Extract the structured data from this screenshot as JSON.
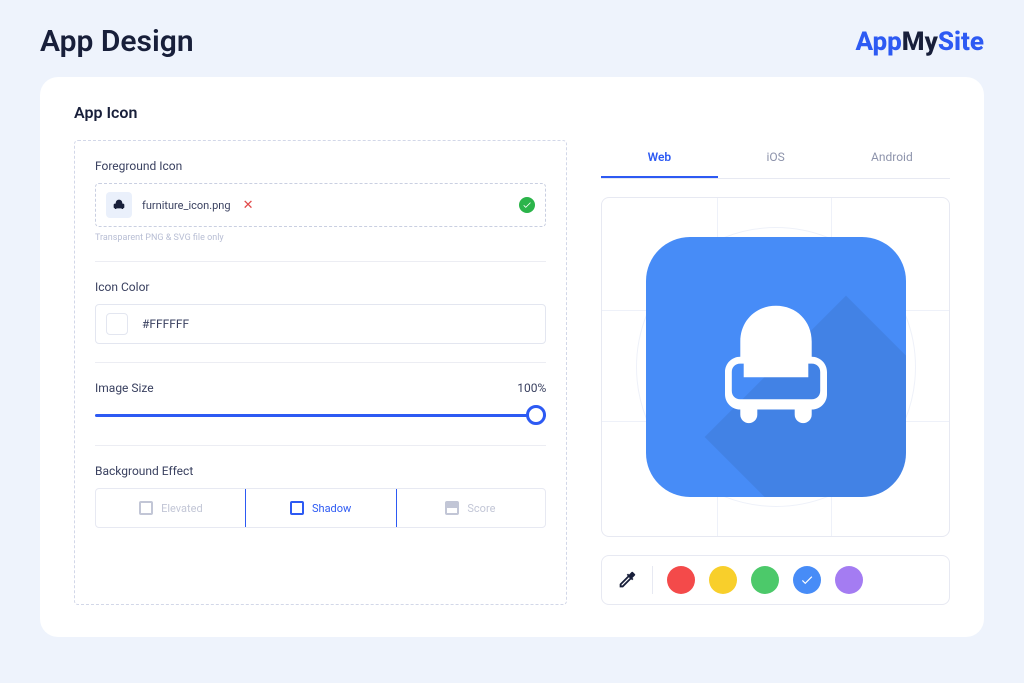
{
  "header": {
    "title": "App Design",
    "brand_part1": "App",
    "brand_part2": "My",
    "brand_part3": "Site"
  },
  "section": {
    "title": "App Icon"
  },
  "foreground": {
    "label": "Foreground Icon",
    "filename": "furniture_icon.png",
    "hint": "Transparent PNG & SVG file only"
  },
  "icon_color": {
    "label": "Icon Color",
    "value": "#FFFFFF"
  },
  "image_size": {
    "label": "Image Size",
    "value_text": "100%",
    "percent": 100
  },
  "background_effect": {
    "label": "Background Effect",
    "options": [
      {
        "label": "Elevated"
      },
      {
        "label": "Shadow"
      },
      {
        "label": "Score"
      }
    ]
  },
  "tabs": {
    "web": "Web",
    "ios": "iOS",
    "android": "Android"
  },
  "palette": {
    "colors": [
      "#f44a4a",
      "#f8cf2b",
      "#4cc96a",
      "#478cf7",
      "#a47cf2"
    ],
    "selected_index": 3
  }
}
